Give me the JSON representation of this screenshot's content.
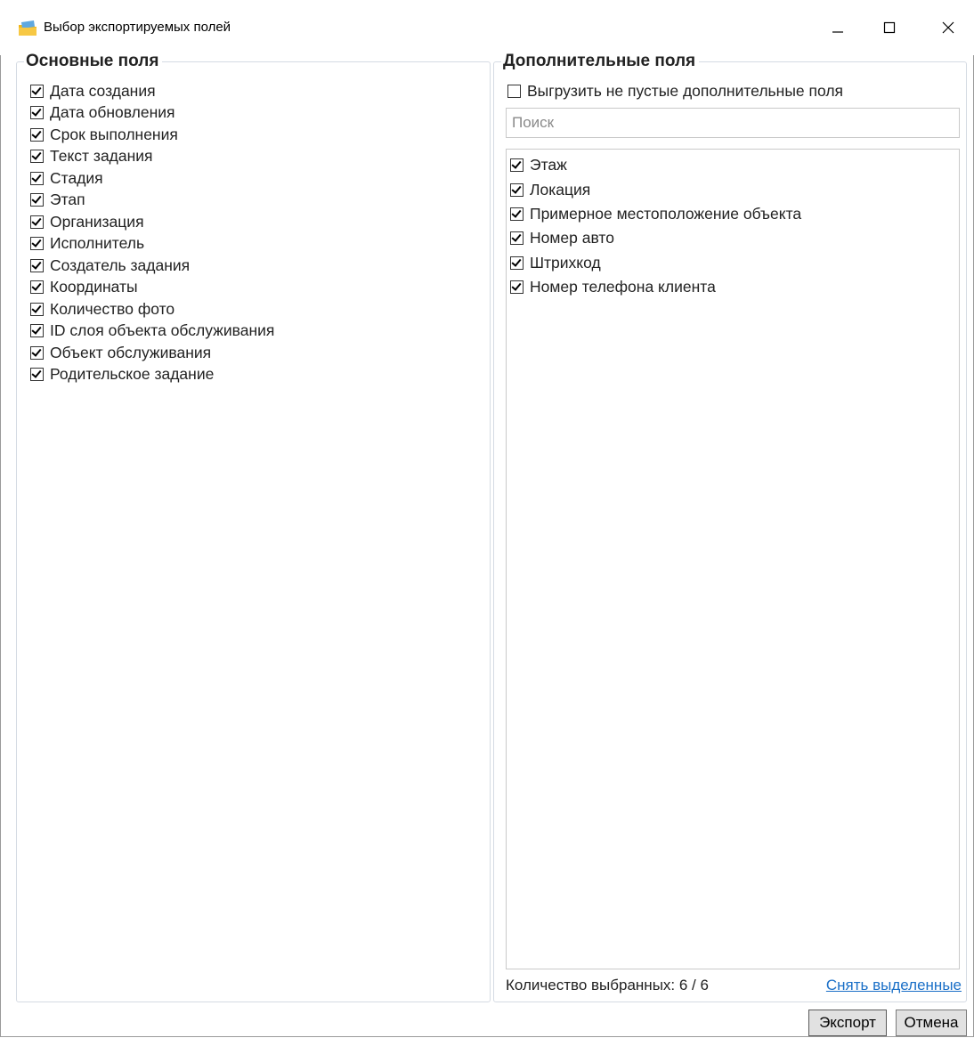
{
  "window": {
    "title": "Выбор экспортируемых полей",
    "icon": "app-folder-icon",
    "controls": [
      "minimize-icon",
      "maximize-icon",
      "close-icon"
    ]
  },
  "main_fields": {
    "title": "Основные поля",
    "items": [
      {
        "label": "Дата создания",
        "checked": true
      },
      {
        "label": "Дата обновления",
        "checked": true
      },
      {
        "label": "Срок выполнения",
        "checked": true
      },
      {
        "label": "Текст задания",
        "checked": true
      },
      {
        "label": "Стадия",
        "checked": true
      },
      {
        "label": "Этап",
        "checked": true
      },
      {
        "label": "Организация",
        "checked": true
      },
      {
        "label": "Исполнитель",
        "checked": true
      },
      {
        "label": "Создатель задания",
        "checked": true
      },
      {
        "label": "Координаты",
        "checked": true
      },
      {
        "label": "Количество фото",
        "checked": true
      },
      {
        "label": "ID слоя объекта обслуживания",
        "checked": true
      },
      {
        "label": "Объект обслуживания",
        "checked": true
      },
      {
        "label": "Родительское задание",
        "checked": true
      }
    ]
  },
  "extra_fields": {
    "title": "Дополнительные поля",
    "export_nonempty": {
      "label": "Выгрузить не пустые дополнительные поля",
      "checked": false
    },
    "search": {
      "placeholder": "Поиск",
      "value": ""
    },
    "items": [
      {
        "label": "Этаж",
        "checked": true
      },
      {
        "label": "Локация",
        "checked": true
      },
      {
        "label": "Примерное местоположение объекта",
        "checked": true
      },
      {
        "label": "Номер авто",
        "checked": true
      },
      {
        "label": "Штрихкод",
        "checked": true
      },
      {
        "label": "Номер телефона клиента",
        "checked": true
      }
    ],
    "count_label": "Количество выбранных: 6 / 6",
    "clear_link": "Снять выделенные"
  },
  "buttons": {
    "export": "Экспорт",
    "cancel": "Отмена"
  },
  "colors": {
    "link": "#1a6fc7",
    "group_border": "#d5dbe3",
    "button_bg": "#e1e1e1"
  }
}
